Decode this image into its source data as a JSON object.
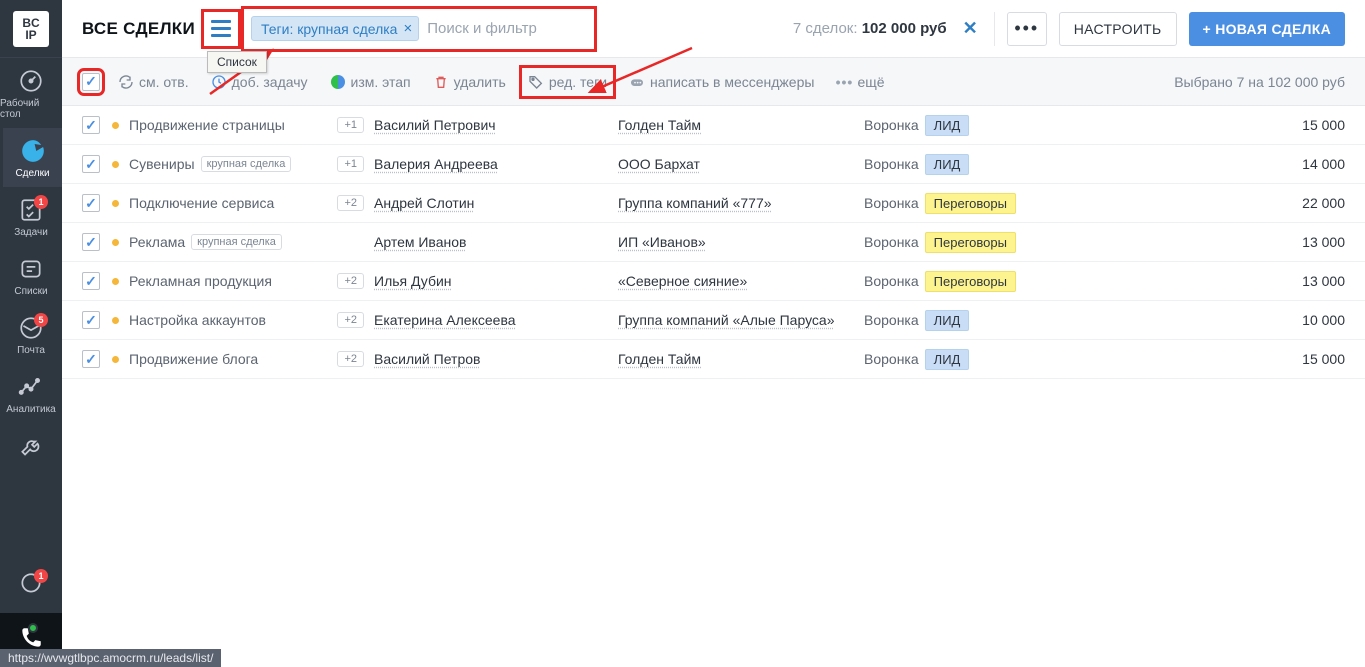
{
  "logo": {
    "top": "BC",
    "bottom": "IP"
  },
  "sidebar": {
    "items": [
      {
        "label": "Рабочий стол"
      },
      {
        "label": "Сделки"
      },
      {
        "label": "Задачи",
        "badge": "1"
      },
      {
        "label": "Списки"
      },
      {
        "label": "Почта",
        "badge": "5"
      },
      {
        "label": "Аналитика"
      }
    ],
    "chat_badge": "1"
  },
  "header": {
    "title": "ВСЕ СДЕЛКИ",
    "burger_tooltip": "Список",
    "filter_chip": "Теги: крупная сделка",
    "search_placeholder": "Поиск и фильтр",
    "summary_prefix": "7 сделок: ",
    "summary_value": "102 000 руб",
    "configure": "НАСТРОИТЬ",
    "new_deal": "+ НОВАЯ СДЕЛКА"
  },
  "toolbar": {
    "change_owner": "см. отв.",
    "add_task": "доб. задачу",
    "change_stage": "изм. этап",
    "delete": "удалить",
    "edit_tags": "ред. теги",
    "messenger": "написать в мессенджеры",
    "more": "ещё",
    "selected": "Выбрано 7 на 102 000 руб"
  },
  "stages": {
    "funnel_label": "Воронка",
    "lead": "ЛИД",
    "neg": "Переговоры"
  },
  "deals": [
    {
      "name": "Продвижение страницы",
      "plus": "+1",
      "contact": "Василий Петрович",
      "company": "Голден Тайм",
      "stage": "lead",
      "price": "15 000",
      "tag": null
    },
    {
      "name": "Сувениры",
      "plus": "+1",
      "contact": "Валерия Андреева",
      "company": "ООО Бархат",
      "stage": "lead",
      "price": "14 000",
      "tag": "крупная сделка"
    },
    {
      "name": "Подключение сервиса",
      "plus": "+2",
      "contact": "Андрей Слотин",
      "company": "Группа компаний «777»",
      "stage": "neg",
      "price": "22 000",
      "tag": null
    },
    {
      "name": "Реклама",
      "plus": null,
      "contact": "Артем Иванов",
      "company": "ИП «Иванов»",
      "stage": "neg",
      "price": "13 000",
      "tag": "крупная сделка"
    },
    {
      "name": "Рекламная продукция",
      "plus": "+2",
      "contact": "Илья Дубин",
      "company": "«Северное сияние»",
      "stage": "neg",
      "price": "13 000",
      "tag": null
    },
    {
      "name": "Настройка аккаунтов",
      "plus": "+2",
      "contact": "Екатерина Алексеева",
      "company": "Группа компаний «Алые Паруса»",
      "stage": "lead",
      "price": "10 000",
      "tag": null
    },
    {
      "name": "Продвижение блога",
      "plus": "+2",
      "contact": "Василий Петров",
      "company": "Голден Тайм",
      "stage": "lead",
      "price": "15 000",
      "tag": null
    }
  ],
  "status_url": "https://wvwgtlbpc.amocrm.ru/leads/list/"
}
